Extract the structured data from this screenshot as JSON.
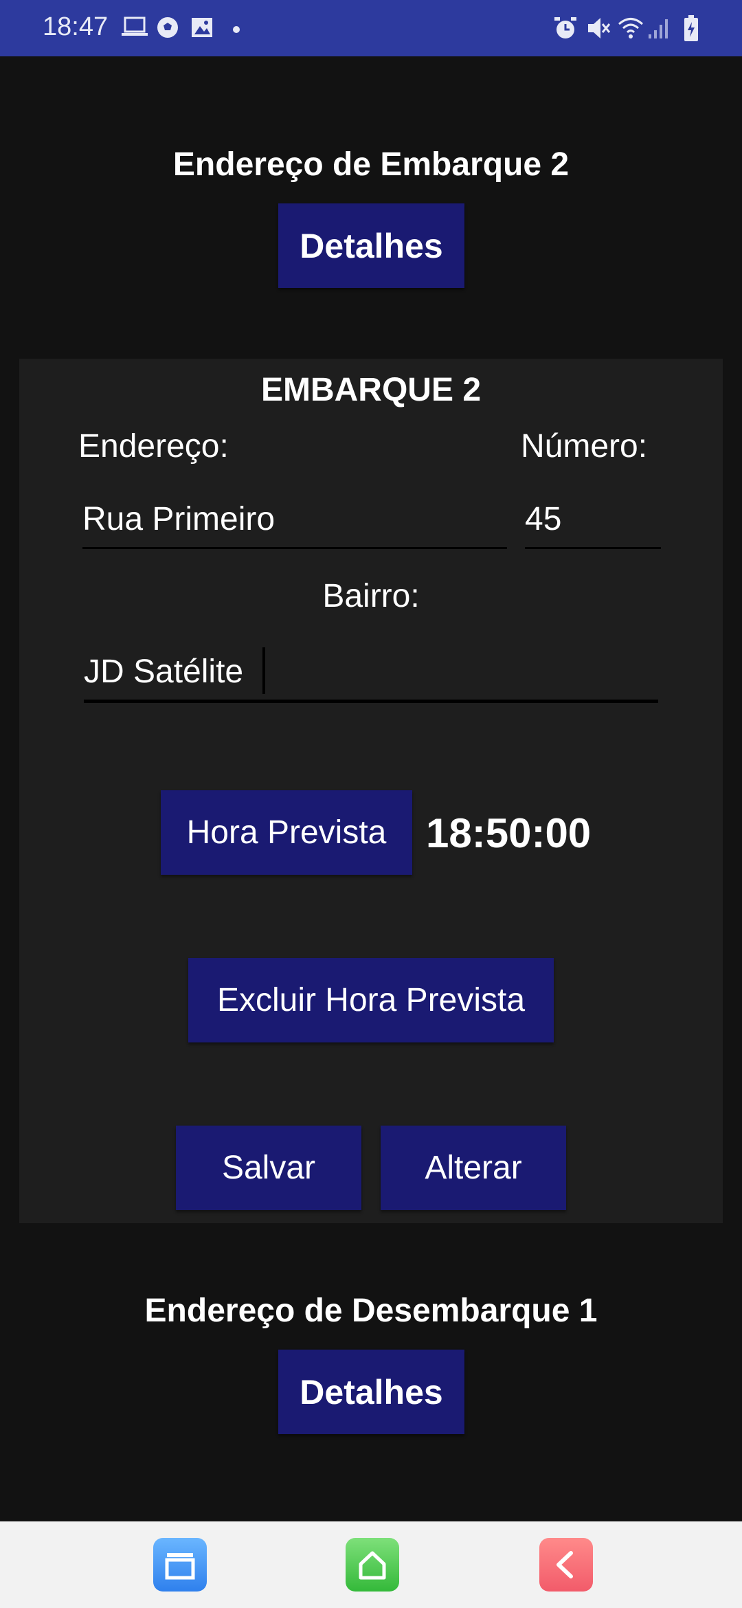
{
  "status_bar": {
    "time": "18:47",
    "left_icons": [
      "laptop-icon",
      "soccer-ball-icon",
      "image-icon",
      "dot-icon"
    ],
    "right_icons": [
      "alarm-icon",
      "mute-icon",
      "data-transfer-icon",
      "wifi-icon",
      "signal-icon",
      "battery-icon"
    ]
  },
  "section_boarding": {
    "title": "Endereço de Embarque 2",
    "details_label": "Detalhes"
  },
  "card": {
    "title": "EMBARQUE 2",
    "address_label": "Endereço:",
    "number_label": "Número:",
    "address_value": "Rua Primeiro",
    "number_value": "45",
    "neighborhood_label": "Bairro:",
    "neighborhood_value": "JD Satélite",
    "hora_prevista_label": "Hora Prevista",
    "hora_prevista_value": "18:50:00",
    "excluir_label": "Excluir Hora Prevista",
    "salvar_label": "Salvar",
    "alterar_label": "Alterar"
  },
  "section_drop": {
    "title": "Endereço de Desembarque 1",
    "details_label": "Detalhes"
  },
  "nav_bar": {
    "icons": [
      "recent-apps-icon",
      "home-icon",
      "back-icon"
    ]
  },
  "colors": {
    "status_bar": "#2d3a9e",
    "button": "#1a1a72",
    "background": "#121212",
    "card": "#1e1e1e"
  }
}
